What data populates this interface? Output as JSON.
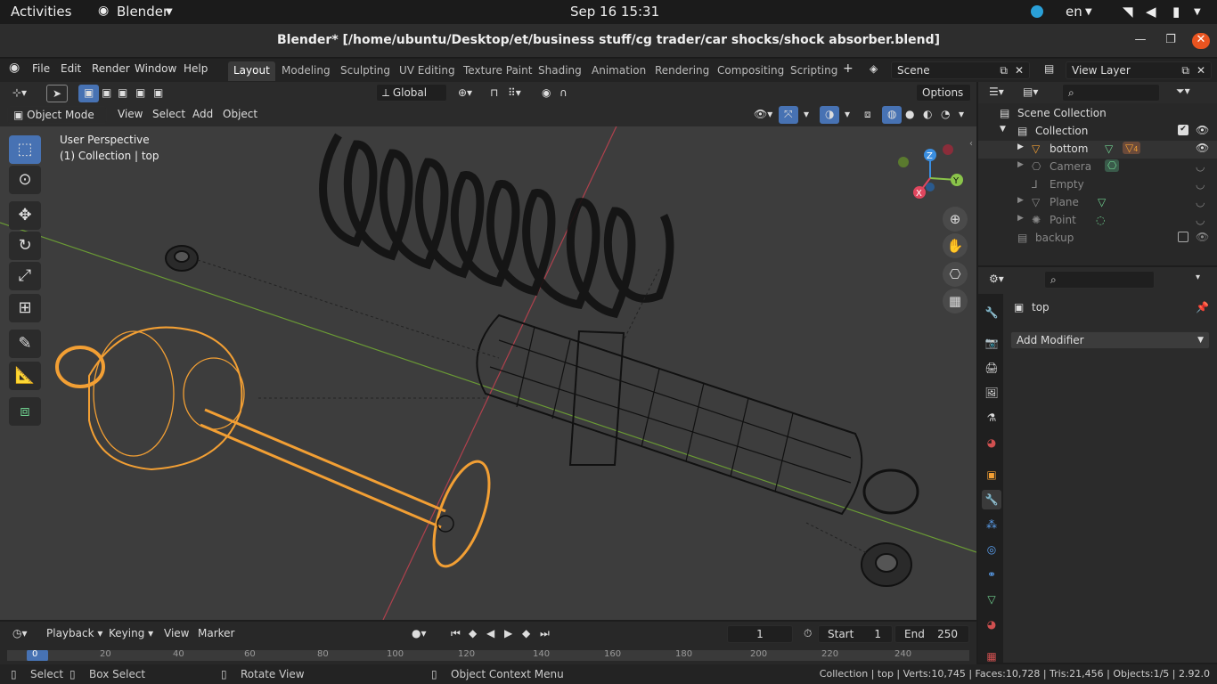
{
  "gnome": {
    "activities": "Activities",
    "app": "Blender",
    "clock": "Sep 16  15:31",
    "lang": "en"
  },
  "window": {
    "title": "Blender* [/home/ubuntu/Desktop/et/business stuff/cg trader/car shocks/shock absorber.blend]"
  },
  "menus": [
    "File",
    "Edit",
    "Render",
    "Window",
    "Help"
  ],
  "workspaces": [
    "Layout",
    "Modeling",
    "Sculpting",
    "UV Editing",
    "Texture Paint",
    "Shading",
    "Animation",
    "Rendering",
    "Compositing",
    "Scripting"
  ],
  "active_workspace": "Layout",
  "scene": "Scene",
  "view_layer": "View Layer",
  "toolbar": {
    "orientation": "Global",
    "options": "Options"
  },
  "viewport_header": {
    "mode": "Object Mode",
    "view": "View",
    "select": "Select",
    "add": "Add",
    "object": "Object"
  },
  "overlay_text": {
    "perspective": "User Perspective",
    "collection": "(1) Collection | top"
  },
  "gizmo": {
    "x": "X",
    "y": "Y",
    "z": "Z"
  },
  "outliner": {
    "scene_collection": "Scene Collection",
    "collection": "Collection",
    "items": [
      "bottom",
      "Camera",
      "Empty",
      "Plane",
      "Point"
    ],
    "backup": "backup",
    "badge": "4"
  },
  "properties": {
    "object": "top",
    "add_modifier": "Add Modifier"
  },
  "timeline": {
    "playback": "Playback",
    "keying": "Keying",
    "view": "View",
    "marker": "Marker",
    "frame": "1",
    "start_label": "Start",
    "start": "1",
    "end_label": "End",
    "end": "250",
    "ticks": [
      "0",
      "20",
      "40",
      "60",
      "80",
      "100",
      "120",
      "140",
      "160",
      "180",
      "200",
      "220",
      "240"
    ]
  },
  "status": {
    "select": "Select",
    "box_select": "Box Select",
    "rotate": "Rotate View",
    "context": "Object Context Menu",
    "stats": "Collection | top | Verts:10,745 | Faces:10,728 | Tris:21,456 | Objects:1/5 | 2.92.0"
  },
  "colors": {
    "accent": "#4772b3",
    "selection": "#f29f34",
    "x_axis": "#e0465e",
    "y_axis": "#8ac44a",
    "z_axis": "#3a8ee0"
  }
}
